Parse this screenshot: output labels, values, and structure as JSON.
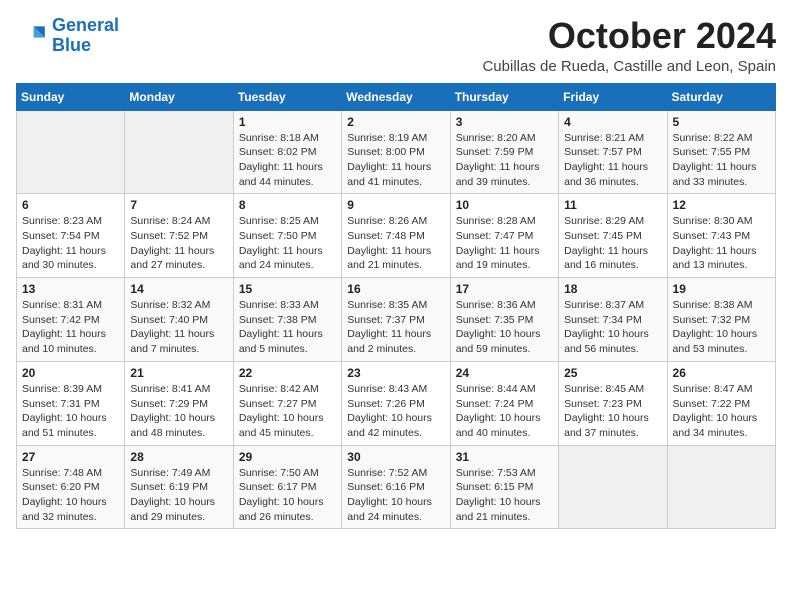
{
  "logo": {
    "text_general": "General",
    "text_blue": "Blue"
  },
  "header": {
    "month": "October 2024",
    "location": "Cubillas de Rueda, Castille and Leon, Spain"
  },
  "weekdays": [
    "Sunday",
    "Monday",
    "Tuesday",
    "Wednesday",
    "Thursday",
    "Friday",
    "Saturday"
  ],
  "weeks": [
    [
      {
        "day": "",
        "info": ""
      },
      {
        "day": "",
        "info": ""
      },
      {
        "day": "1",
        "info": "Sunrise: 8:18 AM\nSunset: 8:02 PM\nDaylight: 11 hours and 44 minutes."
      },
      {
        "day": "2",
        "info": "Sunrise: 8:19 AM\nSunset: 8:00 PM\nDaylight: 11 hours and 41 minutes."
      },
      {
        "day": "3",
        "info": "Sunrise: 8:20 AM\nSunset: 7:59 PM\nDaylight: 11 hours and 39 minutes."
      },
      {
        "day": "4",
        "info": "Sunrise: 8:21 AM\nSunset: 7:57 PM\nDaylight: 11 hours and 36 minutes."
      },
      {
        "day": "5",
        "info": "Sunrise: 8:22 AM\nSunset: 7:55 PM\nDaylight: 11 hours and 33 minutes."
      }
    ],
    [
      {
        "day": "6",
        "info": "Sunrise: 8:23 AM\nSunset: 7:54 PM\nDaylight: 11 hours and 30 minutes."
      },
      {
        "day": "7",
        "info": "Sunrise: 8:24 AM\nSunset: 7:52 PM\nDaylight: 11 hours and 27 minutes."
      },
      {
        "day": "8",
        "info": "Sunrise: 8:25 AM\nSunset: 7:50 PM\nDaylight: 11 hours and 24 minutes."
      },
      {
        "day": "9",
        "info": "Sunrise: 8:26 AM\nSunset: 7:48 PM\nDaylight: 11 hours and 21 minutes."
      },
      {
        "day": "10",
        "info": "Sunrise: 8:28 AM\nSunset: 7:47 PM\nDaylight: 11 hours and 19 minutes."
      },
      {
        "day": "11",
        "info": "Sunrise: 8:29 AM\nSunset: 7:45 PM\nDaylight: 11 hours and 16 minutes."
      },
      {
        "day": "12",
        "info": "Sunrise: 8:30 AM\nSunset: 7:43 PM\nDaylight: 11 hours and 13 minutes."
      }
    ],
    [
      {
        "day": "13",
        "info": "Sunrise: 8:31 AM\nSunset: 7:42 PM\nDaylight: 11 hours and 10 minutes."
      },
      {
        "day": "14",
        "info": "Sunrise: 8:32 AM\nSunset: 7:40 PM\nDaylight: 11 hours and 7 minutes."
      },
      {
        "day": "15",
        "info": "Sunrise: 8:33 AM\nSunset: 7:38 PM\nDaylight: 11 hours and 5 minutes."
      },
      {
        "day": "16",
        "info": "Sunrise: 8:35 AM\nSunset: 7:37 PM\nDaylight: 11 hours and 2 minutes."
      },
      {
        "day": "17",
        "info": "Sunrise: 8:36 AM\nSunset: 7:35 PM\nDaylight: 10 hours and 59 minutes."
      },
      {
        "day": "18",
        "info": "Sunrise: 8:37 AM\nSunset: 7:34 PM\nDaylight: 10 hours and 56 minutes."
      },
      {
        "day": "19",
        "info": "Sunrise: 8:38 AM\nSunset: 7:32 PM\nDaylight: 10 hours and 53 minutes."
      }
    ],
    [
      {
        "day": "20",
        "info": "Sunrise: 8:39 AM\nSunset: 7:31 PM\nDaylight: 10 hours and 51 minutes."
      },
      {
        "day": "21",
        "info": "Sunrise: 8:41 AM\nSunset: 7:29 PM\nDaylight: 10 hours and 48 minutes."
      },
      {
        "day": "22",
        "info": "Sunrise: 8:42 AM\nSunset: 7:27 PM\nDaylight: 10 hours and 45 minutes."
      },
      {
        "day": "23",
        "info": "Sunrise: 8:43 AM\nSunset: 7:26 PM\nDaylight: 10 hours and 42 minutes."
      },
      {
        "day": "24",
        "info": "Sunrise: 8:44 AM\nSunset: 7:24 PM\nDaylight: 10 hours and 40 minutes."
      },
      {
        "day": "25",
        "info": "Sunrise: 8:45 AM\nSunset: 7:23 PM\nDaylight: 10 hours and 37 minutes."
      },
      {
        "day": "26",
        "info": "Sunrise: 8:47 AM\nSunset: 7:22 PM\nDaylight: 10 hours and 34 minutes."
      }
    ],
    [
      {
        "day": "27",
        "info": "Sunrise: 7:48 AM\nSunset: 6:20 PM\nDaylight: 10 hours and 32 minutes."
      },
      {
        "day": "28",
        "info": "Sunrise: 7:49 AM\nSunset: 6:19 PM\nDaylight: 10 hours and 29 minutes."
      },
      {
        "day": "29",
        "info": "Sunrise: 7:50 AM\nSunset: 6:17 PM\nDaylight: 10 hours and 26 minutes."
      },
      {
        "day": "30",
        "info": "Sunrise: 7:52 AM\nSunset: 6:16 PM\nDaylight: 10 hours and 24 minutes."
      },
      {
        "day": "31",
        "info": "Sunrise: 7:53 AM\nSunset: 6:15 PM\nDaylight: 10 hours and 21 minutes."
      },
      {
        "day": "",
        "info": ""
      },
      {
        "day": "",
        "info": ""
      }
    ]
  ]
}
